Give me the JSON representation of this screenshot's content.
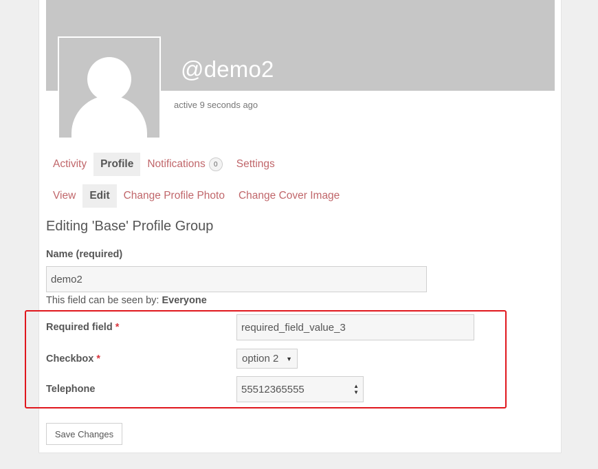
{
  "profile": {
    "username": "@demo2",
    "activity": "active 9 seconds ago"
  },
  "nav": {
    "items": [
      {
        "label": "Activity",
        "active": false
      },
      {
        "label": "Profile",
        "active": true
      },
      {
        "label": "Notifications",
        "active": false,
        "badge": "0"
      },
      {
        "label": "Settings",
        "active": false
      }
    ]
  },
  "subnav": {
    "items": [
      {
        "label": "View",
        "active": false
      },
      {
        "label": "Edit",
        "active": true
      },
      {
        "label": "Change Profile Photo",
        "active": false
      },
      {
        "label": "Change Cover Image",
        "active": false
      }
    ]
  },
  "form": {
    "title": "Editing 'Base' Profile Group",
    "name_label": "Name (required)",
    "name_value": "demo2",
    "visibility_prefix": "This field can be seen by: ",
    "visibility_value": "Everyone",
    "required_field_label": "Required field",
    "required_marker": "*",
    "required_field_value": "required_field_value_3",
    "checkbox_label": "Checkbox",
    "checkbox_value": "option 2",
    "telephone_label": "Telephone",
    "telephone_value": "55512365555",
    "save_label": "Save Changes"
  },
  "colors": {
    "link": "#c0666a",
    "highlight": "#e0161c",
    "cover": "#c6c6c6"
  }
}
